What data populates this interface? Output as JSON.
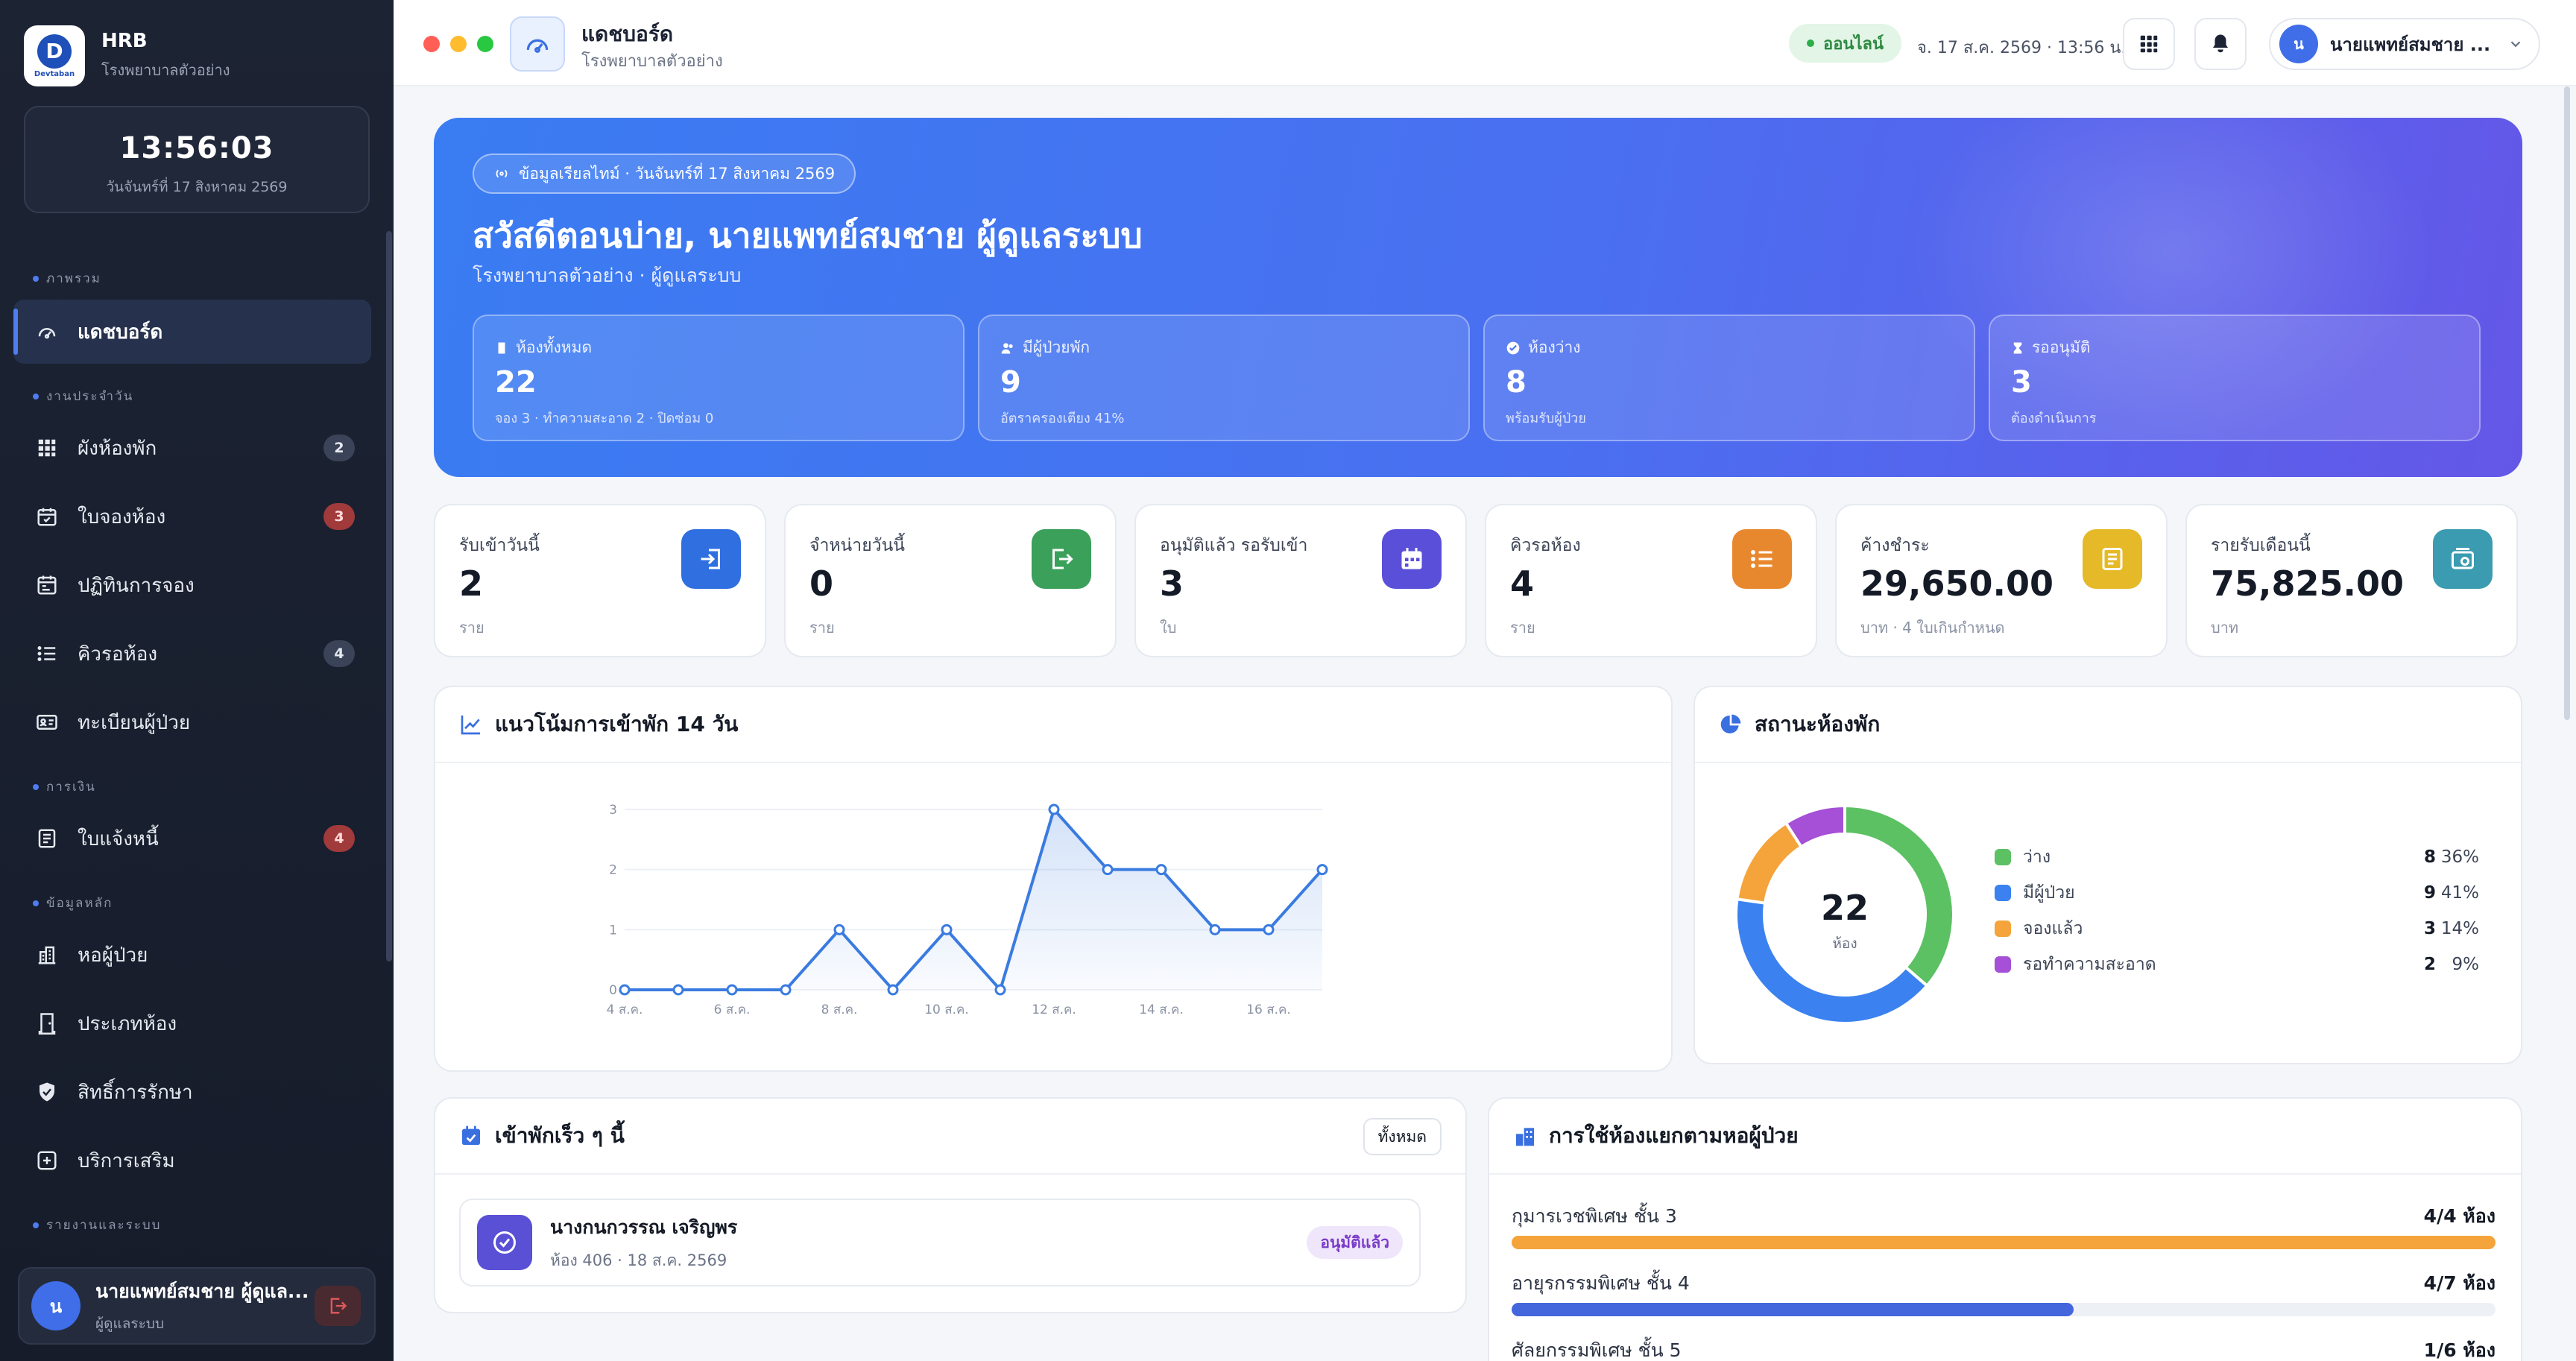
{
  "brand": {
    "logo_text": "Devtaban",
    "name": "HRB",
    "subtitle": "โรงพยาบาลตัวอย่าง"
  },
  "clock": {
    "time": "13:56:03",
    "date": "วันจันทร์ที่ 17 สิงหาคม 2569"
  },
  "sidebar": {
    "sections": {
      "overview": "ภาพรวม",
      "daily": "งานประจำวัน",
      "finance": "การเงิน",
      "master": "ข้อมูลหลัก",
      "reports": "รายงานและระบบ"
    },
    "items": [
      {
        "label": "แดชบอร์ด",
        "icon": "gauge-icon"
      },
      {
        "label": "ผังห้องพัก",
        "icon": "grid-icon",
        "badge": "2"
      },
      {
        "label": "ใบจองห้อง",
        "icon": "calendar-check-icon",
        "badge": "3"
      },
      {
        "label": "ปฏิทินการจอง",
        "icon": "calendar-icon"
      },
      {
        "label": "คิวรอห้อง",
        "icon": "list-icon",
        "badge": "4"
      },
      {
        "label": "ทะเบียนผู้ป่วย",
        "icon": "id-card-icon"
      },
      {
        "label": "ใบแจ้งหนี้",
        "icon": "invoice-icon",
        "badge": "4"
      },
      {
        "label": "หอผู้ป่วย",
        "icon": "building-icon"
      },
      {
        "label": "ประเภทห้อง",
        "icon": "door-icon"
      },
      {
        "label": "สิทธิ์การรักษา",
        "icon": "shield-icon"
      },
      {
        "label": "บริการเสริม",
        "icon": "plus-square-icon"
      }
    ],
    "user": {
      "initial": "น",
      "name": "นายแพทย์สมชาย ผู้ดูแล...",
      "role": "ผู้ดูแลระบบ"
    }
  },
  "topbar": {
    "title": "แดชบอร์ด",
    "subtitle": "โรงพยาบาลตัวอย่าง",
    "status": "ออนไลน์",
    "datetime": "จ. 17 ส.ค. 2569 · 13:56 น.",
    "user_initial": "น",
    "user_name": "นายแพทย์สมชาย ..."
  },
  "hero": {
    "pill": "ข้อมูลเรียลไทม์ · วันจันทร์ที่ 17 สิงหาคม 2569",
    "title": "สวัสดีตอนบ่าย, นายแพทย์สมชาย ผู้ดูแลระบบ",
    "subtitle": "โรงพยาบาลตัวอย่าง · ผู้ดูแลระบบ",
    "cards": [
      {
        "label": "ห้องทั้งหมด",
        "value": "22",
        "note": "จอง 3 · ทำความสะอาด 2 · ปิดซ่อม 0"
      },
      {
        "label": "มีผู้ป่วยพัก",
        "value": "9",
        "note": "อัตราครองเตียง 41%"
      },
      {
        "label": "ห้องว่าง",
        "value": "8",
        "note": "พร้อมรับผู้ป่วย"
      },
      {
        "label": "รออนุมัติ",
        "value": "3",
        "note": "ต้องดำเนินการ"
      }
    ]
  },
  "stats": [
    {
      "label": "รับเข้าวันนี้",
      "value": "2",
      "unit": "ราย",
      "color": "#2f6fe0"
    },
    {
      "label": "จำหน่ายวันนี้",
      "value": "0",
      "unit": "ราย",
      "color": "#3aa05a"
    },
    {
      "label": "อนุมัติแล้ว รอรับเข้า",
      "value": "3",
      "unit": "ใบ",
      "color": "#5a4fd8"
    },
    {
      "label": "คิวรอห้อง",
      "value": "4",
      "unit": "ราย",
      "color": "#e8882e"
    },
    {
      "label": "ค้างชำระ",
      "value": "29,650.00",
      "unit": "บาท · 4 ใบเกินกำหนด",
      "color": "#e5b928"
    },
    {
      "label": "รายรับเดือนนี้",
      "value": "75,825.00",
      "unit": "บาท",
      "color": "#3b9bb0"
    }
  ],
  "trend": {
    "title": "แนวโน้มการเข้าพัก 14 วัน"
  },
  "chart_data": [
    {
      "type": "line",
      "title": "แนวโน้มการเข้าพัก 14 วัน",
      "x": [
        "4 ส.ค.",
        "5 ส.ค.",
        "6 ส.ค.",
        "7 ส.ค.",
        "8 ส.ค.",
        "9 ส.ค.",
        "10 ส.ค.",
        "11 ส.ค.",
        "12 ส.ค.",
        "13 ส.ค.",
        "14 ส.ค.",
        "15 ส.ค.",
        "16 ส.ค.",
        "17 ส.ค."
      ],
      "x_tick_labels": [
        "4 ส.ค.",
        "6 ส.ค.",
        "8 ส.ค.",
        "10 ส.ค.",
        "12 ส.ค.",
        "14 ส.ค.",
        "16 ส.ค."
      ],
      "values": [
        0,
        0,
        0,
        0,
        1,
        0,
        1,
        0,
        3,
        2,
        2,
        1,
        1,
        2
      ],
      "y_ticks": [
        "0",
        "1",
        "2",
        "3"
      ],
      "ylim": [
        0,
        3
      ],
      "grid": true,
      "color": "#3a7be0"
    },
    {
      "type": "pie",
      "title": "สถานะห้องพัก",
      "center_value": "22",
      "center_label": "ห้อง",
      "slices": [
        {
          "name": "ว่าง",
          "value": 8,
          "pct": "36%",
          "color": "#5cc163"
        },
        {
          "name": "มีผู้ป่วย",
          "value": 9,
          "pct": "41%",
          "color": "#3b82f0"
        },
        {
          "name": "จองแล้ว",
          "value": 3,
          "pct": "14%",
          "color": "#f4a43a"
        },
        {
          "name": "รอทำความสะอาด",
          "value": 2,
          "pct": "9%",
          "color": "#a550d6"
        }
      ]
    }
  ],
  "upcoming": {
    "title": "เข้าพักเร็ว ๆ นี้",
    "all_label": "ทั้งหมด",
    "items": [
      {
        "name": "นางกนกวรรณ เจริญพร",
        "detail": "ห้อง 406 · 18 ส.ค. 2569",
        "status": "อนุมัติแล้ว"
      }
    ]
  },
  "wards": {
    "title": "การใช้ห้องแยกตามหอผู้ป่วย",
    "items": [
      {
        "name": "กุมารเวชพิเศษ ชั้น 3",
        "value": "4/4 ห้อง",
        "ratio": 1.0,
        "color": "#f4a43a"
      },
      {
        "name": "อายุรกรรมพิเศษ ชั้น 4",
        "value": "4/7 ห้อง",
        "ratio": 0.571,
        "color": "#4466dd"
      },
      {
        "name": "ศัลยกรรมพิเศษ ชั้น 5",
        "value": "1/6 ห้อง",
        "ratio": 0.167,
        "color": "#3b82f0"
      }
    ]
  }
}
